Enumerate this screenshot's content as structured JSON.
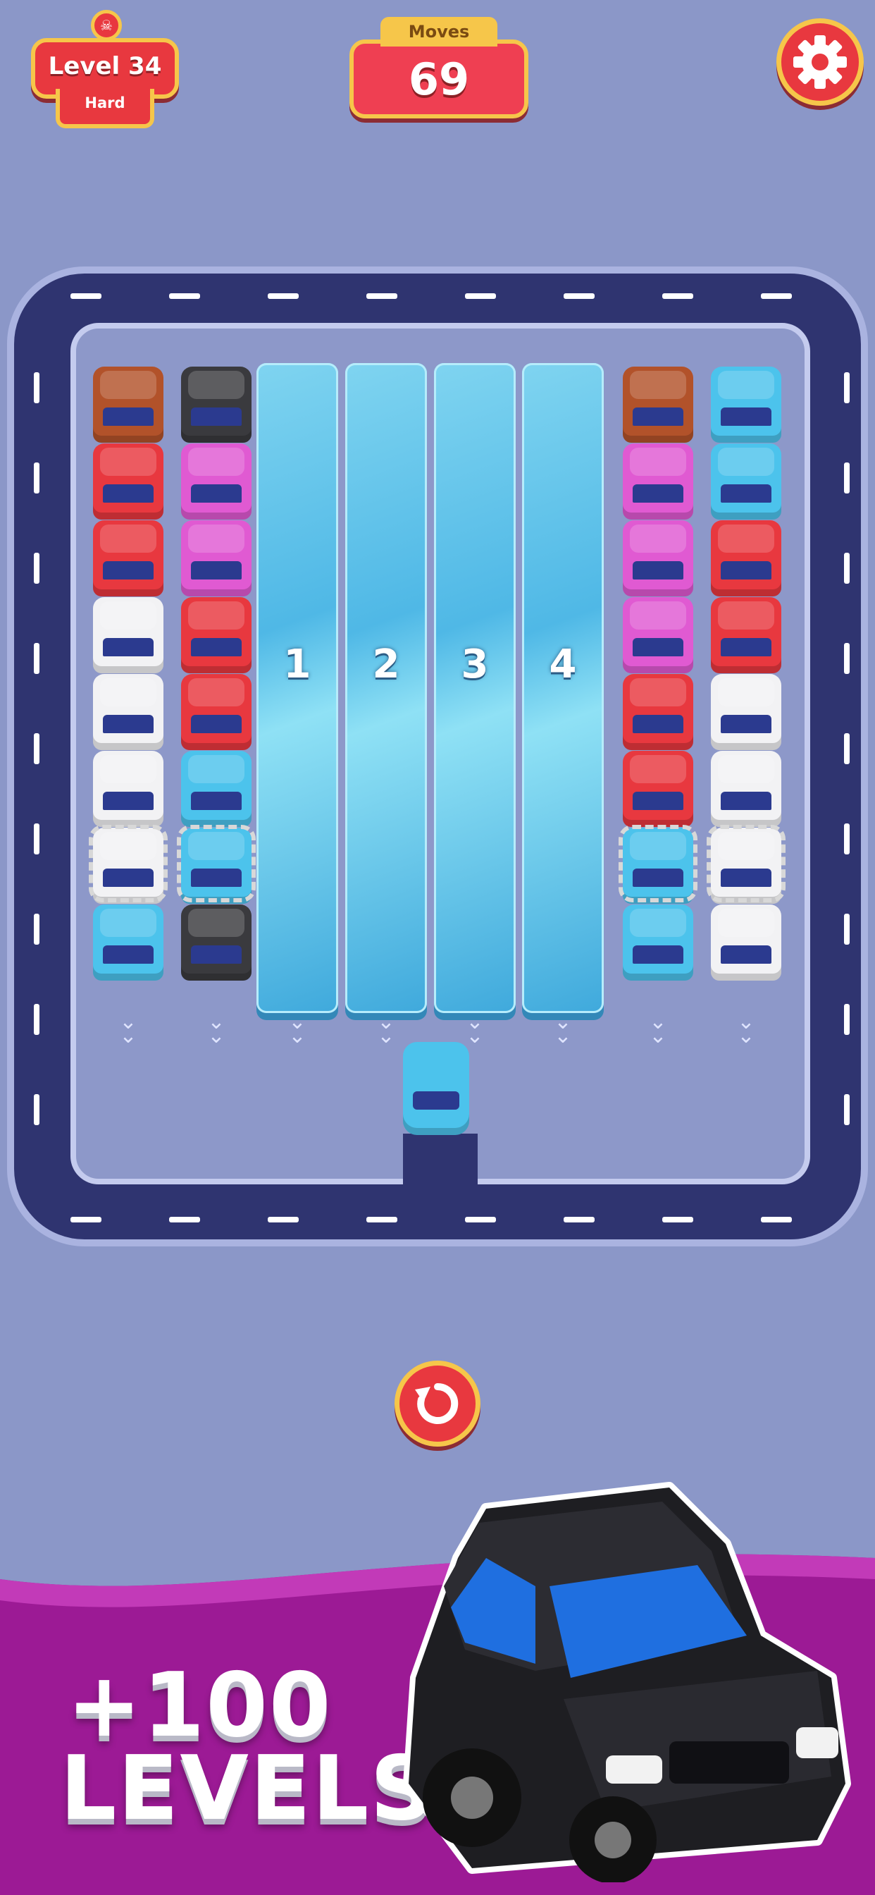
{
  "header": {
    "level_label": "Level 34",
    "difficulty": "Hard",
    "moves_label": "Moves",
    "moves_value": "69"
  },
  "colors": {
    "background": "#8b97c8",
    "road": "#2f3470",
    "badge_red": "#e8383f",
    "badge_gold": "#f6c64a",
    "promo_purple": "#9c1a95"
  },
  "board": {
    "lanes": [
      {
        "cars": [
          "brown",
          "red",
          "red",
          "white",
          "white",
          "white",
          "white",
          "blue"
        ],
        "chained": true
      },
      {
        "cars": [
          "black",
          "pink",
          "pink",
          "red",
          "red",
          "blue",
          "blue",
          "black"
        ],
        "chained": true
      },
      {
        "ice": "1"
      },
      {
        "ice": "2"
      },
      {
        "ice": "3"
      },
      {
        "ice": "4"
      },
      {
        "cars": [
          "brown",
          "pink",
          "pink",
          "pink",
          "red",
          "red",
          "blue",
          "blue"
        ],
        "chained": true
      },
      {
        "cars": [
          "blue",
          "blue",
          "red",
          "red",
          "white",
          "white",
          "white",
          "white"
        ],
        "chained": true
      }
    ],
    "exit_car": "blue"
  },
  "icons": {
    "settings": "gear-icon",
    "restart": "restart-icon",
    "skull": "skull-icon",
    "chevron": "chevron-down-icon"
  },
  "promo": {
    "line1": "+100",
    "line2": "LEVELS"
  }
}
